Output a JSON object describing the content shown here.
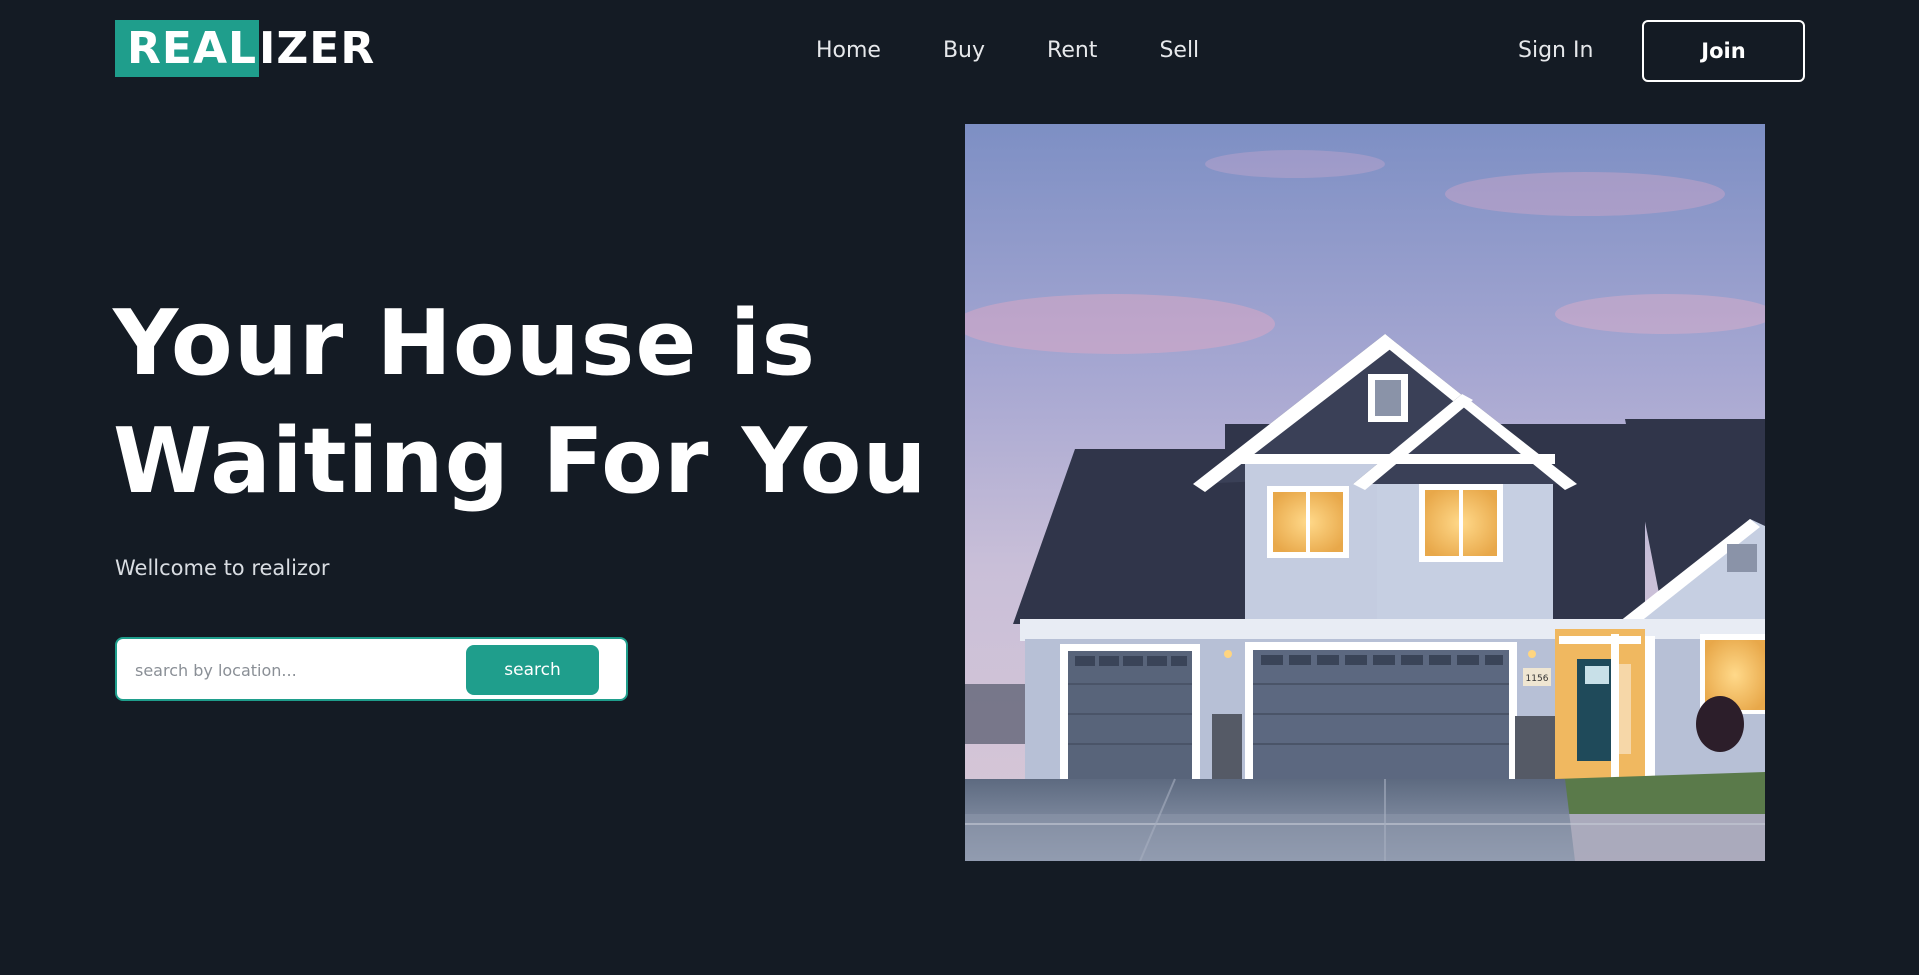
{
  "brand": {
    "logo_highlight": "REAL",
    "logo_rest": "IZER"
  },
  "nav": {
    "items": [
      "Home",
      "Buy",
      "Rent",
      "Sell"
    ]
  },
  "auth": {
    "signin_label": "Sign In",
    "join_label": "Join"
  },
  "hero": {
    "title_line1": "Your House is",
    "title_line2": "Waiting For You",
    "subtitle": "Wellcome to realizor"
  },
  "search": {
    "placeholder": "search by location...",
    "button_label": "search"
  },
  "image": {
    "house_number": "1156"
  },
  "colors": {
    "background": "#141b24",
    "accent": "#1f9e8c",
    "text": "#ffffff"
  }
}
